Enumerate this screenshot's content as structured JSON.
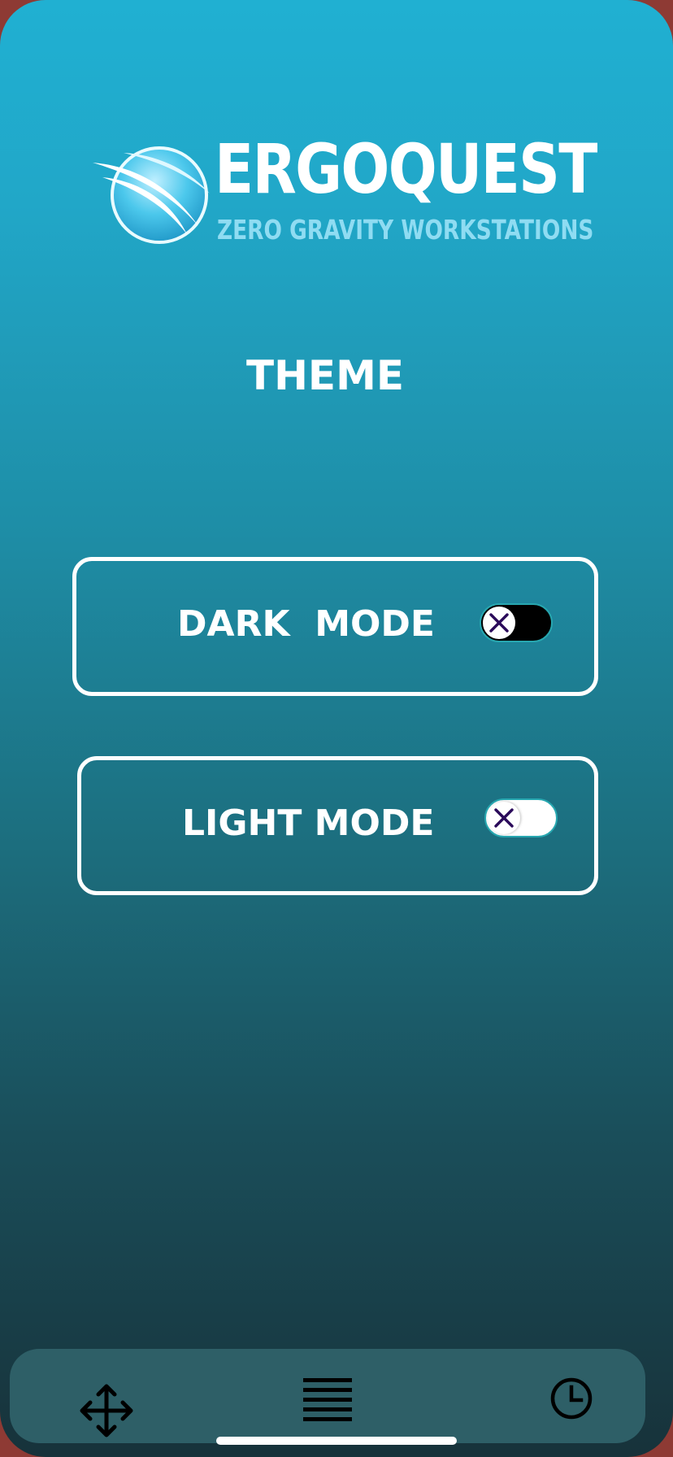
{
  "brand": {
    "name": "ERGOQUEST",
    "tagline": "ZERO GRAVITY WORKSTATIONS",
    "emblem_icon": "globe-swoosh-logo"
  },
  "theme_screen": {
    "title": "THEME",
    "options": [
      {
        "label": "DARK  MODE",
        "enabled": false,
        "toggle_style": "dark",
        "knob_icon": "close-icon"
      },
      {
        "label": "LIGHT MODE",
        "enabled": false,
        "toggle_style": "light",
        "knob_icon": "close-icon"
      }
    ]
  },
  "tab_bar": {
    "tabs": [
      {
        "icon": "move-arrows-icon"
      },
      {
        "icon": "menu-lines-icon"
      },
      {
        "icon": "clock-icon"
      }
    ]
  },
  "colors": {
    "gradient_top": "#20b0d2",
    "gradient_bottom": "#17323a",
    "tab_bar": "#2e5f67",
    "toggle_border": "#27a7b0",
    "knob_x": "#2a0a5a",
    "tagline": "#8fdcf2",
    "frame": "#8e3a34"
  }
}
